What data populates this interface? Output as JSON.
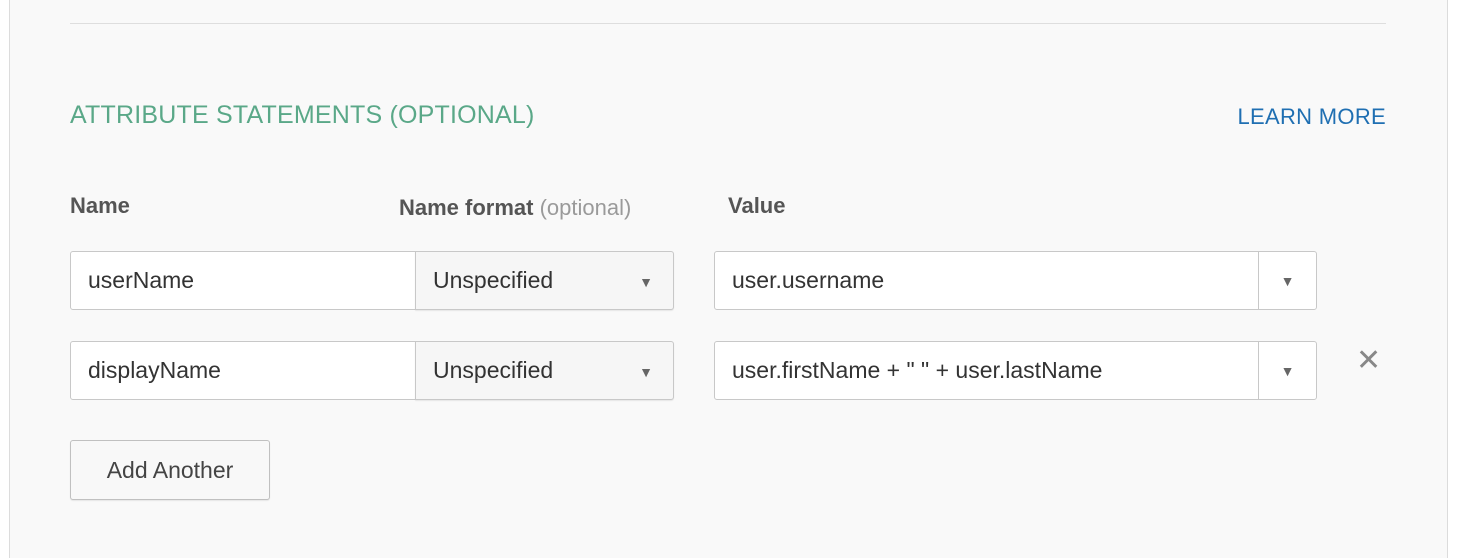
{
  "section": {
    "title": "ATTRIBUTE STATEMENTS (OPTIONAL)",
    "learn_more": "LEARN MORE"
  },
  "columns": {
    "name": "Name",
    "name_format": "Name format",
    "name_format_optional": "(optional)",
    "value": "Value"
  },
  "rows": [
    {
      "name": "userName",
      "format": "Unspecified",
      "value": "user.username"
    },
    {
      "name": "displayName",
      "format": "Unspecified",
      "value": "user.firstName + \" \" + user.lastName"
    }
  ],
  "icons": {
    "dropdown": "▼",
    "remove": "✕"
  },
  "add_button": "Add Another",
  "colors": {
    "section_title": "#5aa888",
    "link": "#1f6fb2"
  }
}
